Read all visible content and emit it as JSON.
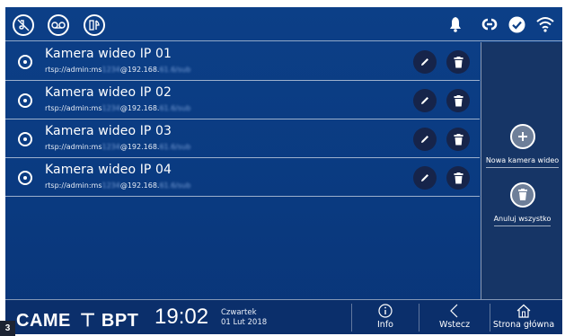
{
  "topbar": {
    "left_icons": [
      "mute-ring-icon",
      "voicemail-icon",
      "restaurant-icon"
    ],
    "right_icons": [
      "bell-icon",
      "link-icon",
      "check-icon",
      "wifi-icon"
    ]
  },
  "cameras": [
    {
      "name": "Kamera wideo IP 01",
      "url_prefix": "rtsp://admin:ms",
      "url_hidden1": "1234",
      "url_mid": "@192.168.",
      "url_hidden2": "61.6/sub"
    },
    {
      "name": "Kamera wideo IP 02",
      "url_prefix": "rtsp://admin:ms",
      "url_hidden1": "1234",
      "url_mid": "@192.168.",
      "url_hidden2": "61.6/sub"
    },
    {
      "name": "Kamera wideo IP 03",
      "url_prefix": "rtsp://admin:ms",
      "url_hidden1": "1234",
      "url_mid": "@192.168.",
      "url_hidden2": "61.6/sub"
    },
    {
      "name": "Kamera wideo IP 04",
      "url_prefix": "rtsp://admin:ms",
      "url_hidden1": "1234",
      "url_mid": "@192.168.",
      "url_hidden2": "61.6/sub"
    }
  ],
  "side": {
    "add_label": "Nowa kamera wideo",
    "delete_all_label": "Anuluj wszystko"
  },
  "bottom": {
    "brand_came": "CAME",
    "brand_bpt": "BPT",
    "time": "19:02",
    "day": "Czwartek",
    "date": "01 Lut 2018",
    "info_label": "Info",
    "back_label": "Wstecz",
    "home_label": "Strona główna"
  },
  "corner_tag": "3",
  "colors": {
    "screen_bg": "#0c3f87",
    "side_bg": "#163566",
    "action_btn": "#16244a",
    "bottom_bg": "#0b2f6b"
  }
}
